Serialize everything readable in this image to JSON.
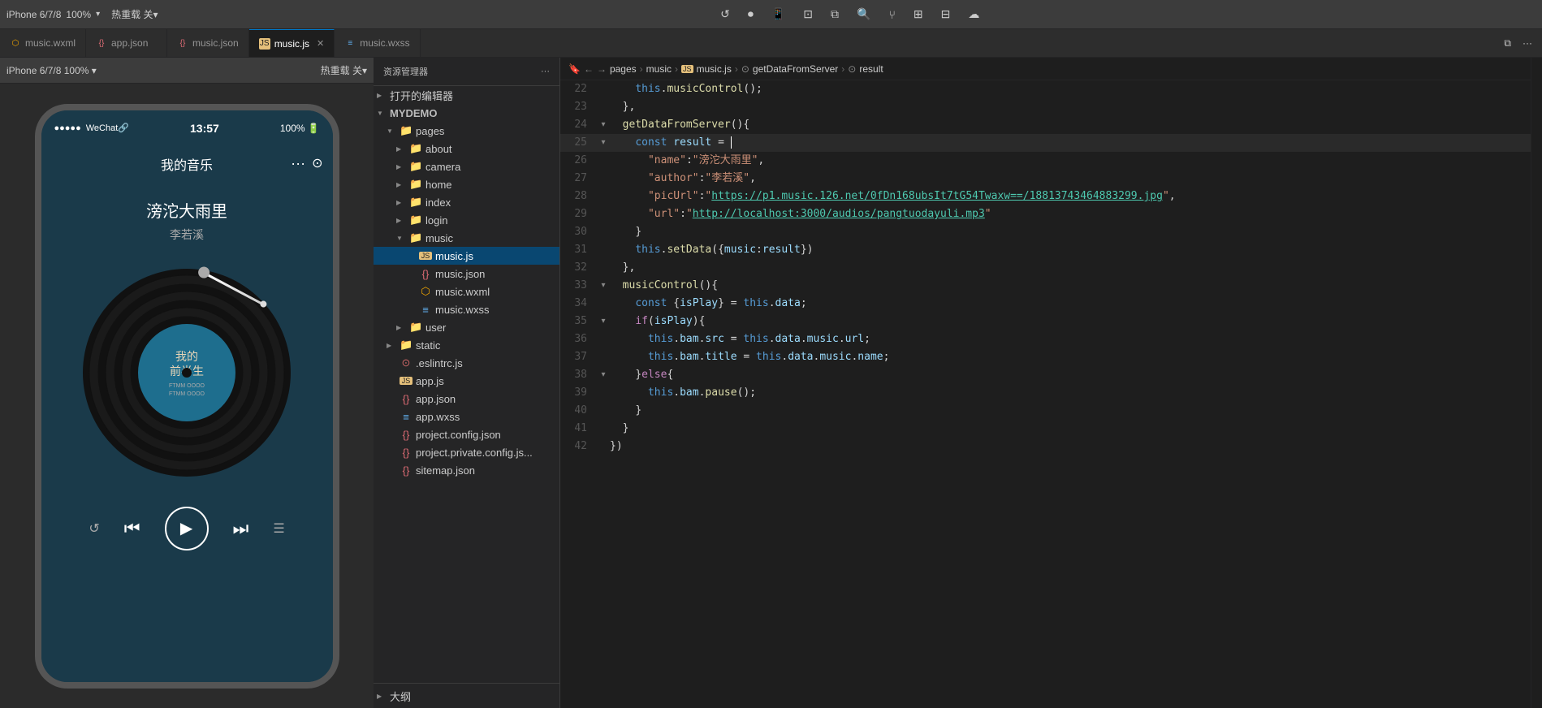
{
  "topbar": {
    "device": "iPhone 6/7/8",
    "zoom": "100%",
    "zoom_dropdown": "▾",
    "hotreload": "热重载 关▾",
    "refresh_icon": "↺",
    "record_icon": "⏺",
    "phone_icon": "📱",
    "window_icon": "⊡",
    "copy_icon": "⧉",
    "search_icon": "🔍",
    "branch_icon": "⑂",
    "grid_icon": "⊞",
    "table_icon": "⊟",
    "cloud_icon": "☁"
  },
  "tabs": [
    {
      "id": "music-wxml",
      "label": "music.wxml",
      "type": "wxml",
      "active": false
    },
    {
      "id": "app-json",
      "label": "app.json",
      "type": "json",
      "active": false
    },
    {
      "id": "music-json",
      "label": "music.json",
      "type": "json",
      "active": false
    },
    {
      "id": "music-js",
      "label": "music.js",
      "type": "js",
      "active": true
    },
    {
      "id": "music-wxss",
      "label": "music.wxss",
      "type": "wxss",
      "active": false
    }
  ],
  "phone": {
    "device_label": "iPhone 6/7/8  100%  ▾",
    "hotreload_label": "热重载 关▾",
    "status_dots": 5,
    "wechat_label": "WeChat🔗",
    "time": "13:57",
    "battery": "100%",
    "page_title": "我的音乐",
    "song_title": "滂沱大雨里",
    "artist": "李若溪",
    "vinyl_text1": "我的",
    "vinyl_text2": "前半生",
    "vinyl_subtext": "FTMM OOOO\nFTMM OOOO"
  },
  "explorer": {
    "title": "资源管理器",
    "menu_icon": "···",
    "sections": {
      "open_editors_label": "打开的编辑器",
      "project_label": "MYDEMO",
      "items": [
        {
          "level": 2,
          "type": "folder",
          "label": "pages",
          "expanded": true,
          "arrow": "▼"
        },
        {
          "level": 3,
          "type": "folder",
          "label": "about",
          "expanded": false,
          "arrow": "▶"
        },
        {
          "level": 3,
          "type": "folder",
          "label": "camera",
          "expanded": false,
          "arrow": "▶"
        },
        {
          "level": 3,
          "type": "folder",
          "label": "home",
          "expanded": false,
          "arrow": "▶"
        },
        {
          "level": 3,
          "type": "folder",
          "label": "index",
          "expanded": false,
          "arrow": "▶"
        },
        {
          "level": 3,
          "type": "folder",
          "label": "login",
          "expanded": false,
          "arrow": "▶"
        },
        {
          "level": 3,
          "type": "folder",
          "label": "music",
          "expanded": true,
          "arrow": "▼"
        },
        {
          "level": 4,
          "type": "js",
          "label": "music.js",
          "selected": true
        },
        {
          "level": 4,
          "type": "json",
          "label": "music.json"
        },
        {
          "level": 4,
          "type": "wxml",
          "label": "music.wxml"
        },
        {
          "level": 4,
          "type": "wxss",
          "label": "music.wxss"
        },
        {
          "level": 3,
          "type": "folder",
          "label": "user",
          "expanded": false,
          "arrow": "▶"
        },
        {
          "level": 2,
          "type": "folder",
          "label": "static",
          "expanded": false,
          "arrow": "▶"
        },
        {
          "level": 2,
          "type": "eslint",
          "label": ".eslintrc.js"
        },
        {
          "level": 2,
          "type": "js",
          "label": "app.js"
        },
        {
          "level": 2,
          "type": "json",
          "label": "app.json"
        },
        {
          "level": 2,
          "type": "wxss",
          "label": "app.wxss"
        },
        {
          "level": 2,
          "type": "json",
          "label": "project.config.json"
        },
        {
          "level": 2,
          "type": "json",
          "label": "project.private.config.js..."
        },
        {
          "level": 2,
          "type": "json",
          "label": "sitemap.json"
        }
      ],
      "bottom_label": "大纲"
    }
  },
  "editor": {
    "breadcrumbs": [
      "pages",
      ">",
      "music",
      ">",
      "music.js",
      ">",
      "getDataFromServer",
      ">",
      "result"
    ],
    "lines": [
      {
        "num": 22,
        "fold": "",
        "code": "    this.musicControl();"
      },
      {
        "num": 23,
        "fold": "",
        "code": "  },"
      },
      {
        "num": 24,
        "fold": "▾",
        "code": "  getDataFromServer(){"
      },
      {
        "num": 25,
        "fold": "▾",
        "code": "    const result = |"
      },
      {
        "num": 26,
        "fold": "",
        "code": "      \"name\":\"滂沱大雨里\","
      },
      {
        "num": 27,
        "fold": "",
        "code": "      \"author\":\"李若溪\","
      },
      {
        "num": 28,
        "fold": "",
        "code": "      \"picUrl\":\"https://p1.music.126.net/0fDn168ubsIt7tG54Twaxw==/18813743464883299.jpg\","
      },
      {
        "num": 29,
        "fold": "",
        "code": "      \"url\":\"http://localhost:3000/audios/pangtuodayuli.mp3\""
      },
      {
        "num": 30,
        "fold": "",
        "code": "    }"
      },
      {
        "num": 31,
        "fold": "",
        "code": "    this.setData({music:result})"
      },
      {
        "num": 32,
        "fold": "",
        "code": "  },"
      },
      {
        "num": 33,
        "fold": "▾",
        "code": "  musicControl(){"
      },
      {
        "num": 34,
        "fold": "",
        "code": "    const {isPlay} = this.data;"
      },
      {
        "num": 35,
        "fold": "▾",
        "code": "    if(isPlay){"
      },
      {
        "num": 36,
        "fold": "",
        "code": "      this.bam.src = this.data.music.url;"
      },
      {
        "num": 37,
        "fold": "",
        "code": "      this.bam.title = this.data.music.name;"
      },
      {
        "num": 38,
        "fold": "▾",
        "code": "    }else{"
      },
      {
        "num": 39,
        "fold": "",
        "code": "      this.bam.pause();"
      },
      {
        "num": 40,
        "fold": "",
        "code": "    }"
      },
      {
        "num": 41,
        "fold": "",
        "code": "  }"
      },
      {
        "num": 42,
        "fold": "",
        "code": "})"
      }
    ]
  }
}
